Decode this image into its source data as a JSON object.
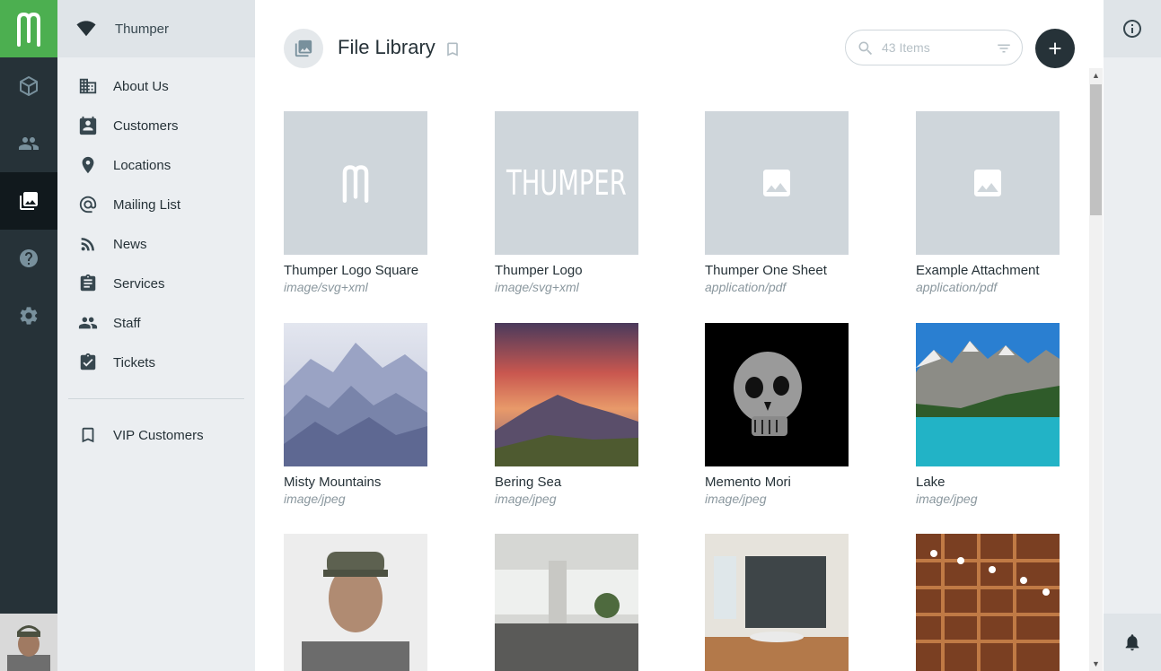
{
  "app": {
    "brand_color": "#4caf50",
    "rail_color": "#263238"
  },
  "rail": {
    "items": [
      {
        "icon": "cube-icon"
      },
      {
        "icon": "people-icon"
      },
      {
        "icon": "photo-library-icon",
        "active": true
      },
      {
        "icon": "help-icon"
      },
      {
        "icon": "settings-icon"
      }
    ]
  },
  "nav": {
    "workspace": "Thumper",
    "items": [
      {
        "label": "About Us",
        "icon": "building-icon"
      },
      {
        "label": "Customers",
        "icon": "contact-card-icon"
      },
      {
        "label": "Locations",
        "icon": "location-pin-icon"
      },
      {
        "label": "Mailing List",
        "icon": "at-sign-icon"
      },
      {
        "label": "News",
        "icon": "rss-icon"
      },
      {
        "label": "Services",
        "icon": "clipboard-icon"
      },
      {
        "label": "Staff",
        "icon": "people-icon"
      },
      {
        "label": "Tickets",
        "icon": "clipboard-check-icon"
      }
    ],
    "saved": [
      {
        "label": "VIP Customers",
        "icon": "bookmark-icon"
      }
    ]
  },
  "header": {
    "title": "File Library",
    "search_placeholder": "43 Items"
  },
  "files": [
    {
      "name": "Thumper Logo Square",
      "mime": "image/svg+xml",
      "thumb": "logo-m"
    },
    {
      "name": "Thumper Logo",
      "mime": "image/svg+xml",
      "thumb": "logo-text",
      "thumb_text": "THUMPER"
    },
    {
      "name": "Thumper One Sheet",
      "mime": "application/pdf",
      "thumb": "placeholder"
    },
    {
      "name": "Example Attachment",
      "mime": "application/pdf",
      "thumb": "placeholder"
    },
    {
      "name": "Misty Mountains",
      "mime": "image/jpeg",
      "thumb": "misty"
    },
    {
      "name": "Bering Sea",
      "mime": "image/jpeg",
      "thumb": "sunset"
    },
    {
      "name": "Memento Mori",
      "mime": "image/jpeg",
      "thumb": "skull"
    },
    {
      "name": "Lake",
      "mime": "image/jpeg",
      "thumb": "lake"
    },
    {
      "name": "",
      "mime": "",
      "thumb": "portrait"
    },
    {
      "name": "",
      "mime": "",
      "thumb": "office"
    },
    {
      "name": "",
      "mime": "",
      "thumb": "meeting"
    },
    {
      "name": "",
      "mime": "",
      "thumb": "shelves"
    }
  ]
}
